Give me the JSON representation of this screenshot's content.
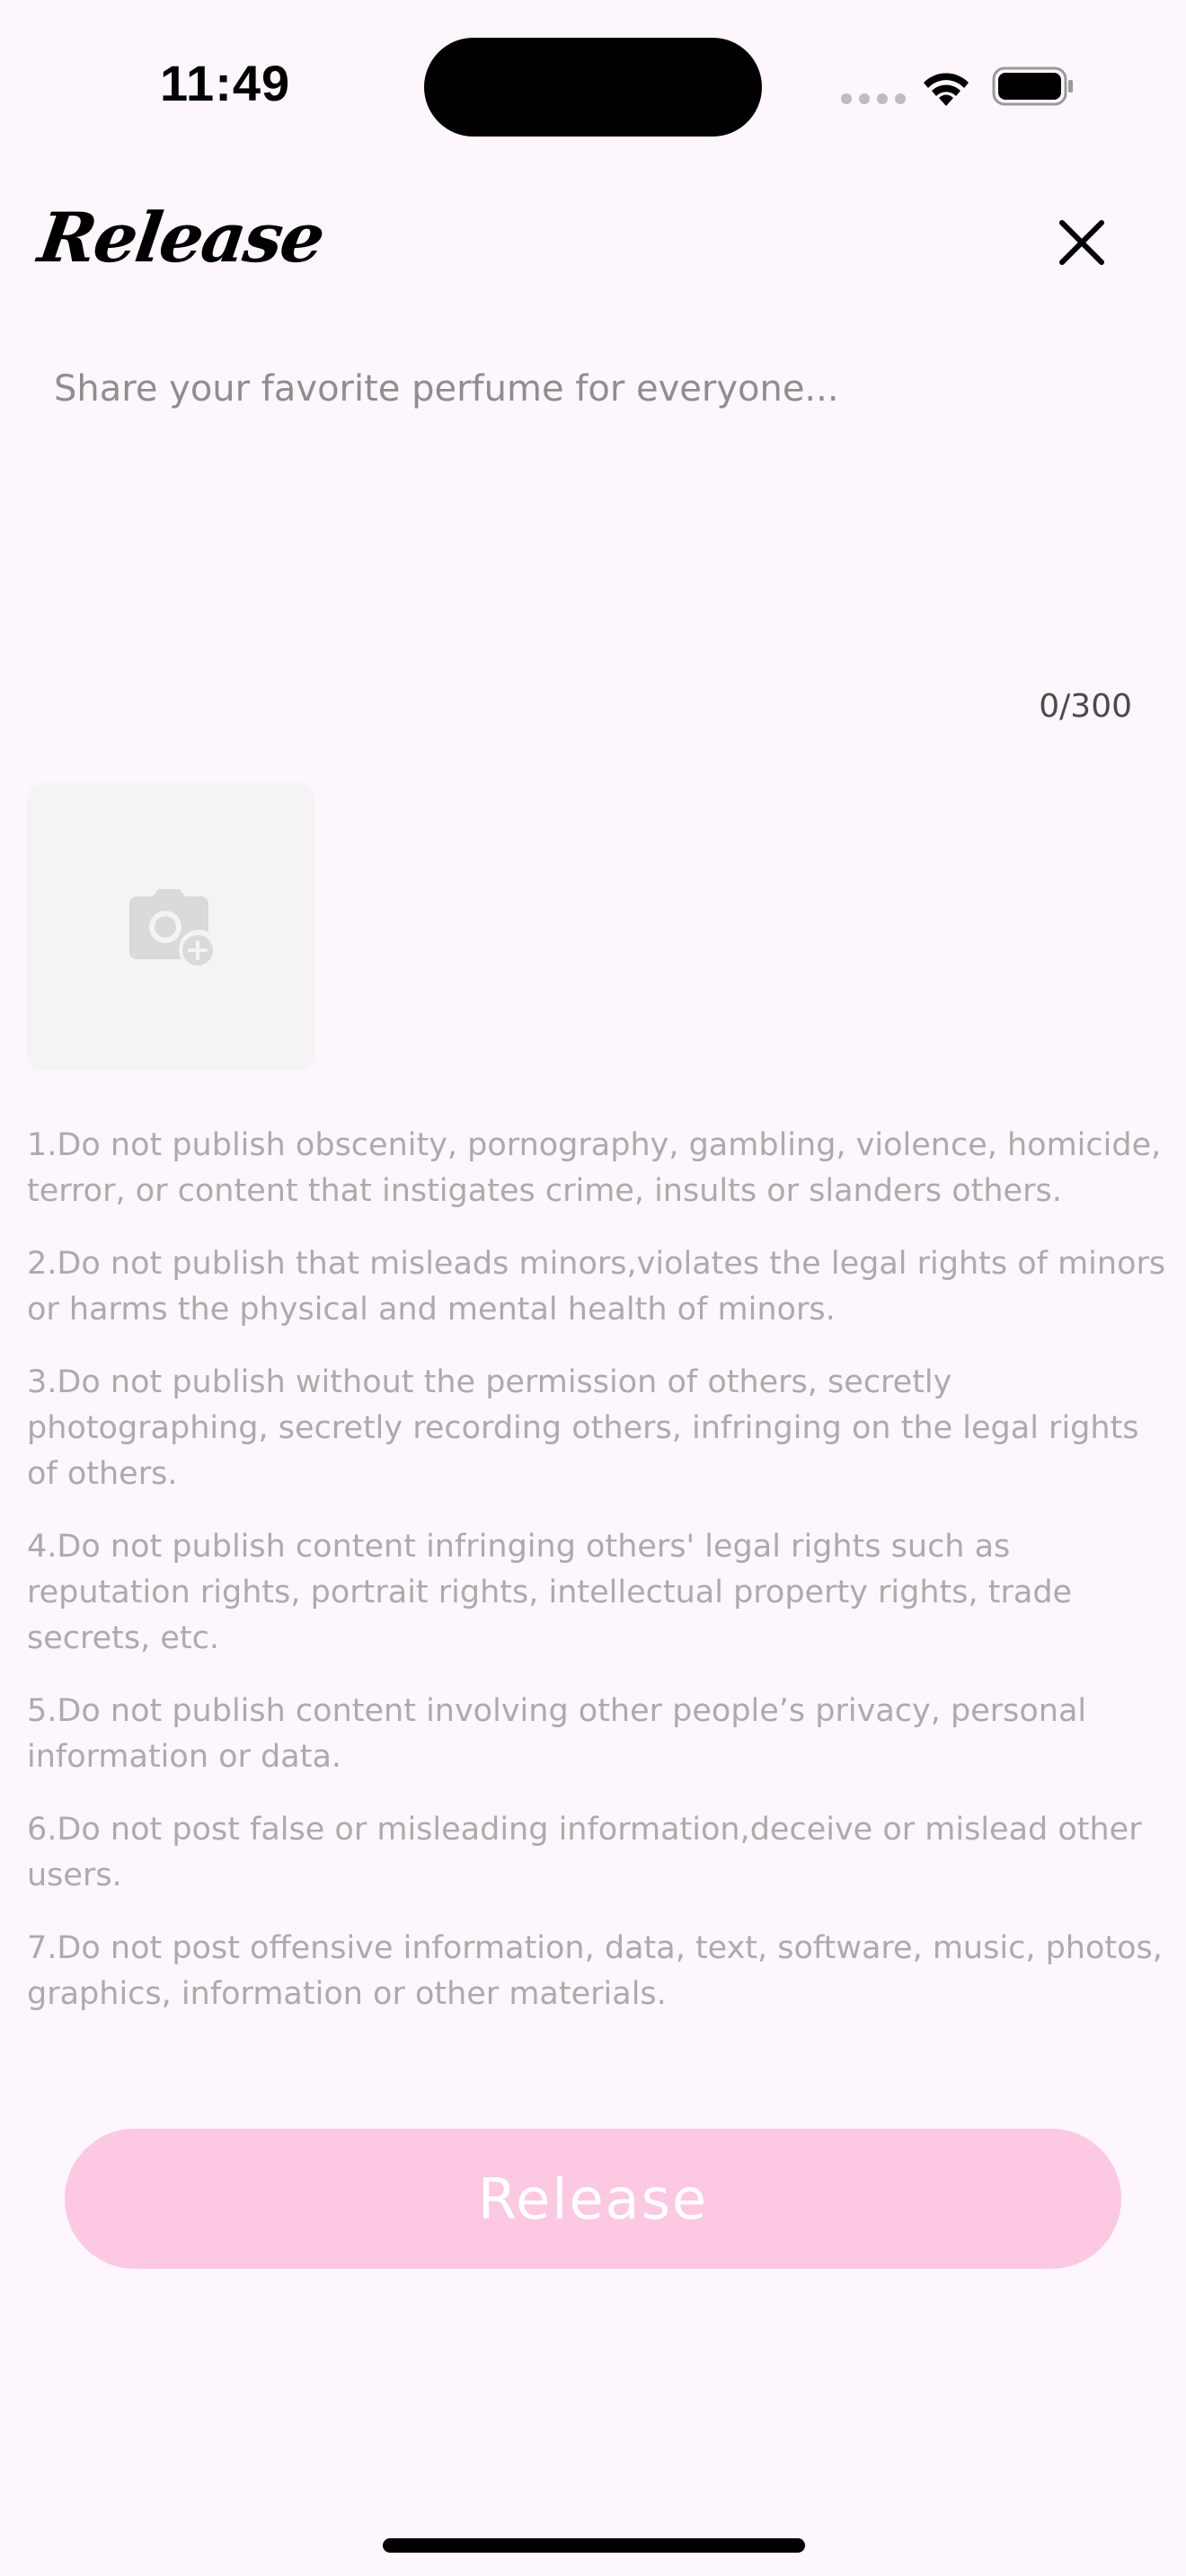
{
  "status_bar": {
    "time": "11:49"
  },
  "header": {
    "title": "Release",
    "close_icon": "close-icon"
  },
  "composer": {
    "placeholder": "Share your favorite perfume for everyone...",
    "value": "",
    "counter": "0/300"
  },
  "upload": {
    "icon": "camera-add-icon"
  },
  "rules": [
    "1.Do not publish obscenity, pornography, gambling, violence, homicide, terror, or content that instigates crime, insults or slanders others.",
    "2.Do not publish that misleads minors,violates the legal rights of minors or harms the physical and mental health of minors.",
    "3.Do not publish without the permission of others, secretly photographing, secretly recording others, infringing on the legal rights of others.",
    "4.Do not publish content infringing others' legal rights such as reputation rights, portrait rights, intellectual property rights, trade secrets, etc.",
    "5.Do not publish content involving other people’s privacy, personal information or data.",
    "6.Do not post false or misleading information,deceive or mislead other users.",
    "7.Do not post offensive information, data, text, software, music, photos, graphics, information or other materials."
  ],
  "release_button": {
    "label": "Release"
  },
  "colors": {
    "background": "#FDF6FC",
    "button": "#FCC8E2",
    "rules_text": "#ABABAB"
  }
}
